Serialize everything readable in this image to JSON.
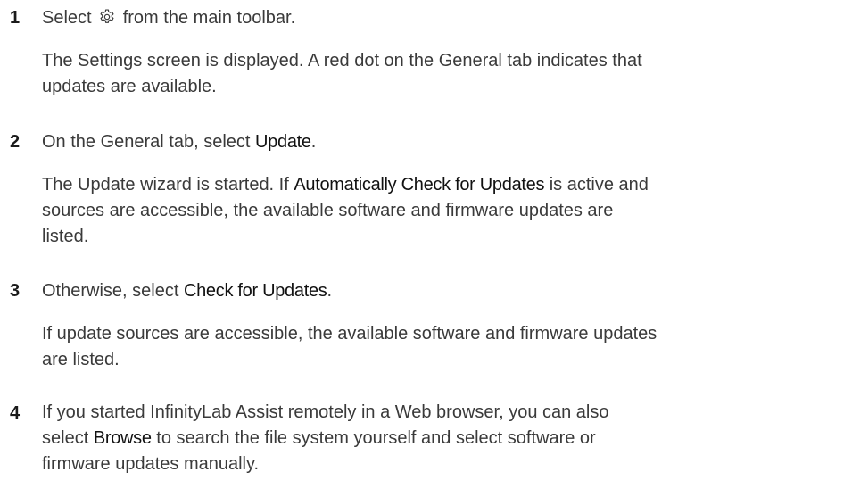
{
  "steps": [
    {
      "number": "1",
      "instruction": {
        "before_icon": "Select",
        "icon": "gear-icon",
        "after_icon": "from the main toolbar."
      },
      "result_lines": [
        "The Settings screen is displayed. A red dot on the General tab indicates that",
        "updates are available."
      ]
    },
    {
      "number": "2",
      "instruction": {
        "prefix": "On the General tab, select ",
        "ui_term": "Update",
        "suffix": "."
      },
      "result": {
        "line1_prefix": "The Update wizard is started. If ",
        "line1_ui_term": "Automatically Check for Updates",
        "line1_suffix": " is active and",
        "line2": "sources are accessible, the available software and firmware updates are",
        "line3": "listed."
      }
    },
    {
      "number": "3",
      "instruction": {
        "prefix": "Otherwise, select ",
        "ui_term": "Check for Updates",
        "suffix": "."
      },
      "result_lines": [
        "If update sources are accessible, the available software and firmware updates",
        "are listed."
      ]
    },
    {
      "number": "4",
      "instruction": {
        "line1": "If you started InfinityLab Assist remotely in a Web browser, you can also",
        "line2_prefix": "select ",
        "line2_ui_term": "Browse",
        "line2_suffix": " to search the file system yourself and select software or",
        "line3": "firmware updates manually."
      }
    }
  ]
}
